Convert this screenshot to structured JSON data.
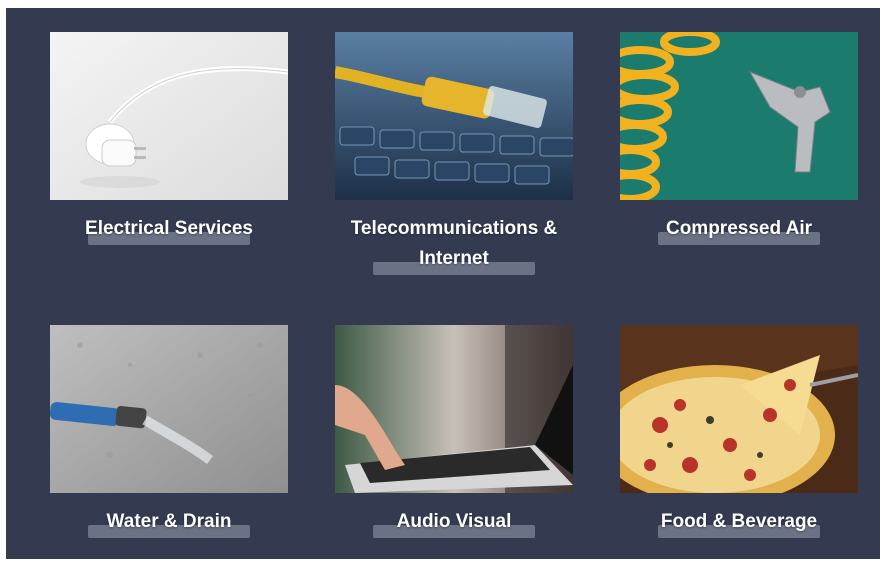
{
  "services": [
    {
      "label": "Electrical Services",
      "icon": "power-plug-photo"
    },
    {
      "label": "Telecommunications & Internet",
      "label_line1": "Telecommunications &",
      "label_line2": "Internet",
      "icon": "ethernet-cable-photo"
    },
    {
      "label": "Compressed Air",
      "icon": "air-gun-photo"
    },
    {
      "label": "Water & Drain",
      "icon": "water-hose-photo"
    },
    {
      "label": "Audio Visual",
      "icon": "laptop-photo"
    },
    {
      "label": "Food & Beverage",
      "icon": "pizza-photo"
    }
  ],
  "colors": {
    "background": "#343b51",
    "label_bar": "#6c7285",
    "label_text": "#ffffff"
  }
}
